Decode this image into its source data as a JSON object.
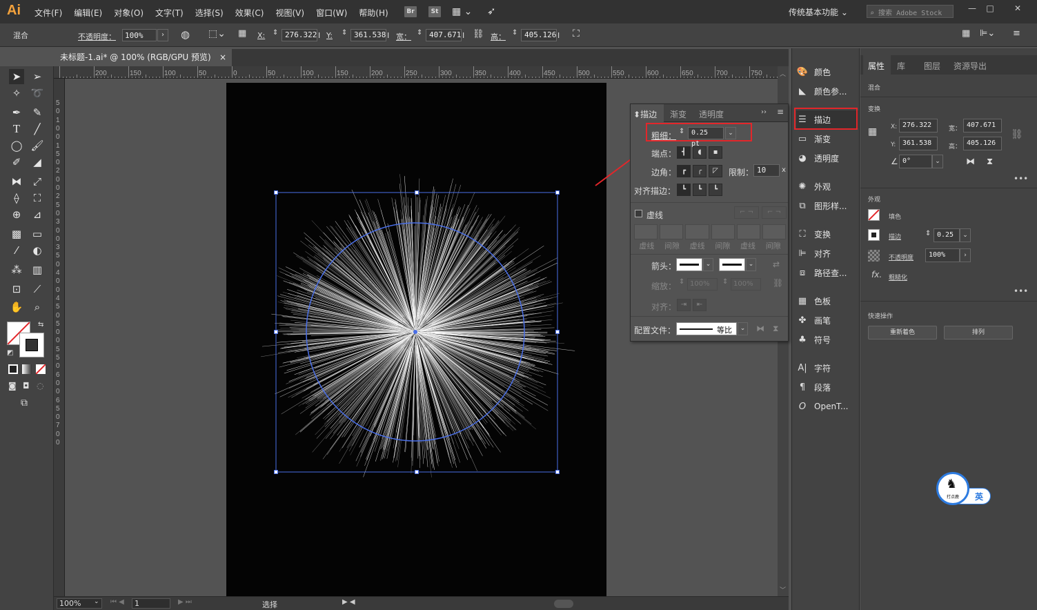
{
  "app": {
    "logo": "Ai"
  },
  "menu": [
    "文件(F)",
    "编辑(E)",
    "对象(O)",
    "文字(T)",
    "选择(S)",
    "效果(C)",
    "视图(V)",
    "窗口(W)",
    "帮助(H)"
  ],
  "titlebar": {
    "br": "Br",
    "st": "St",
    "workspace": "传统基本功能",
    "search_placeholder": "搜索 Adobe Stock",
    "min": "—",
    "max": "□",
    "close": "✕"
  },
  "control": {
    "blend": "混合",
    "opacity_label": "不透明度：",
    "opacity": "100%",
    "x_label": "X:",
    "x": "276.322",
    "y_label": "Y:",
    "y": "361.538",
    "w_label": "宽：",
    "w": "407.671",
    "h_label": "高：",
    "h": "405.126",
    "unit": "I"
  },
  "doc": {
    "tab": "未标题-1.ai* @ 100% (RGB/GPU 预览)",
    "close": "×"
  },
  "ruler_h": [
    "200",
    "150",
    "100",
    "50",
    "0",
    "50",
    "100",
    "150",
    "200",
    "250",
    "300",
    "350",
    "400",
    "450",
    "500",
    "550",
    "600",
    "650",
    "700",
    "750"
  ],
  "ruler_v": [
    "5",
    "0",
    "1",
    "0",
    "0",
    "1",
    "5",
    "0",
    "2",
    "0",
    "0",
    "2",
    "5",
    "0",
    "3",
    "0",
    "0",
    "3",
    "5",
    "0",
    "4",
    "0",
    "0",
    "4",
    "5",
    "0",
    "5",
    "0",
    "0",
    "5",
    "5",
    "0",
    "6",
    "0",
    "0",
    "6",
    "5",
    "0",
    "7",
    "0",
    "0"
  ],
  "status": {
    "zoom": "100%",
    "page": "1",
    "mode": "选择"
  },
  "stroke_panel": {
    "tabs": [
      "描边",
      "渐变",
      "透明度"
    ],
    "weight_label": "粗细：",
    "weight": "0.25 pt",
    "cap_label": "端点：",
    "corner_label": "边角：",
    "limit_label": "限制：",
    "limit": "10",
    "limit_unit": "x",
    "align_label": "对齐描边：",
    "dashed_label": "虚线",
    "dash_cols": [
      "虚线",
      "间隙",
      "虚线",
      "间隙",
      "虚线",
      "间隙"
    ],
    "arrow_label": "箭头：",
    "scale_label": "缩放：",
    "scale1": "100%",
    "scale2": "100%",
    "align2_label": "对齐：",
    "profile_label": "配置文件：",
    "profile": "等比"
  },
  "panel_strip": [
    "颜色",
    "颜色参...",
    "描边",
    "渐变",
    "透明度",
    "外观",
    "图形样...",
    "变换",
    "对齐",
    "路径查...",
    "色板",
    "画笔",
    "符号",
    "字符",
    "段落",
    "OpenT..."
  ],
  "props": {
    "tabs": [
      "属性",
      "库",
      "图层",
      "资源导出"
    ],
    "blend": "混合",
    "transform": "变换",
    "x_label": "X:",
    "x": "276.322",
    "w_label": "宽：",
    "w": "407.671",
    "y_label": "Y:",
    "y": "361.538",
    "h_label": "高：",
    "h": "405.126",
    "angle": "0°",
    "appearance": "外观",
    "fill": "填色",
    "stroke": "描边",
    "stroke_val": "0.25",
    "opacity": "不透明度",
    "opacity_val": "100%",
    "fx": "fx.",
    "roughen": "粗糙化",
    "quick": "快速操作",
    "recolor": "重新着色",
    "arrange": "排列"
  },
  "ime": {
    "lang": "英",
    "brand": "打点鹿"
  }
}
